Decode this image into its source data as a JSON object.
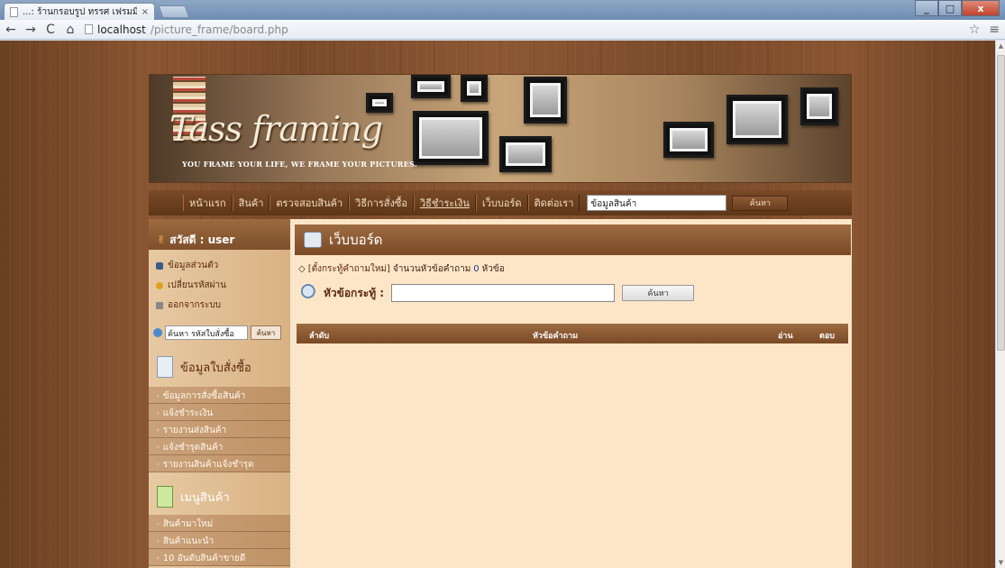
{
  "browser": {
    "tab_title": "...: ร้านกรอบรูป ทรรศ เฟรมมิ่ง",
    "tab_close": "×",
    "url_host": "localhost",
    "url_path": "/picture_frame/board.php",
    "back": "←",
    "forward": "→",
    "reload": "C",
    "home": "⌂",
    "star": "☆",
    "menu": "≡"
  },
  "banner": {
    "logo_text": "Tass framing",
    "tagline": "YOU FRAME YOUR LIFE, WE FRAME YOUR PICTURES."
  },
  "nav": {
    "items": [
      "หน้าแรก",
      "สินค้า",
      "ตรวจสอบสินค้า",
      "วิธีการสั่งซื้อ",
      "วิธีชำระเงิน",
      "เว็บบอร์ด",
      "ติดต่อเรา"
    ],
    "search_value": "ข้อมูลสินค้า",
    "search_button": "ค้นหา"
  },
  "sidebar": {
    "greeting": "สวัสดี : user",
    "account_links": [
      "ข้อมูลส่วนตัว",
      "เปลี่ยนรหัสผ่าน",
      "ออกจากระบบ"
    ],
    "order_search_value": "ค้นหา รหัสใบสั่งซื้อ",
    "order_search_button": "ค้นหา",
    "section_orders": "ข้อมูลใบสั่งซื้อ",
    "order_links": [
      "ข้อมูลการสั่งซื้อสินค้า",
      "แจ้งชำระเงิน",
      "รายงานส่งสินค้า",
      "แจ้งชำรุดสินค้า",
      "รายงานสินค้าแจ้งชำรุด"
    ],
    "section_products": "เมนูสินค้า",
    "product_links": [
      "สินค้ามาใหม่",
      "สินค้าแนะนำ",
      "10 อันดับสินค้าขายดี"
    ]
  },
  "board": {
    "title": "เว็บบอร์ด",
    "new_topic_link": "[ตั้งกระทู้คำถามใหม่]",
    "topic_count_prefix": "จำนวนหัวข้อคำถาม",
    "topic_count": "0",
    "topic_count_suffix": "หัวข้อ",
    "search_label": "หัวข้อกระทู้ :",
    "search_button": "ค้นหา",
    "columns": [
      "ลำดับ",
      "หัวข้อคำถาม",
      "อ่าน",
      "ตอบ"
    ]
  }
}
